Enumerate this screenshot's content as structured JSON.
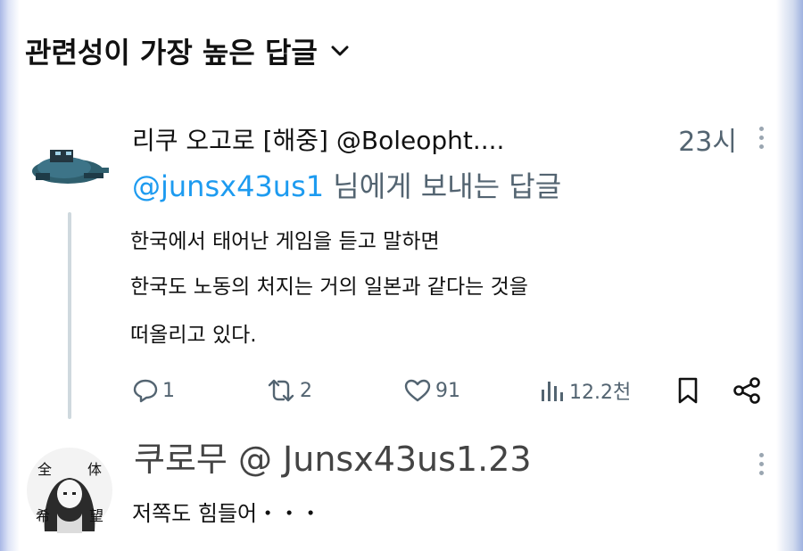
{
  "header": {
    "sort_label": "관련성이 가장 높은 답글"
  },
  "tweet": {
    "author": "리쿠 오고로 [해중] @Boleopht....",
    "time": "23시",
    "reply_to_handle": "@junsx43us1",
    "reply_to_suffix": " 님에게 보내는 답글",
    "lines": [
      "한국에서 태어난 게임을 듣고 말하면",
      "한국도 노동의 처지는 거의 일본과 같다는 것을",
      "떠올리고 있다."
    ],
    "stats": {
      "replies": "1",
      "retweets": "2",
      "likes": "91",
      "views": "12.2천"
    }
  },
  "reply2": {
    "header": "쿠로무 @ Junsx43us1.23",
    "text": "저쪽도 힘들어・・・",
    "avatar_glyphs": [
      "全",
      "体",
      "希",
      "望"
    ]
  },
  "colors": {
    "accent": "#1d9bf0",
    "muted": "#536471",
    "thread_line": "#cfd9de"
  }
}
